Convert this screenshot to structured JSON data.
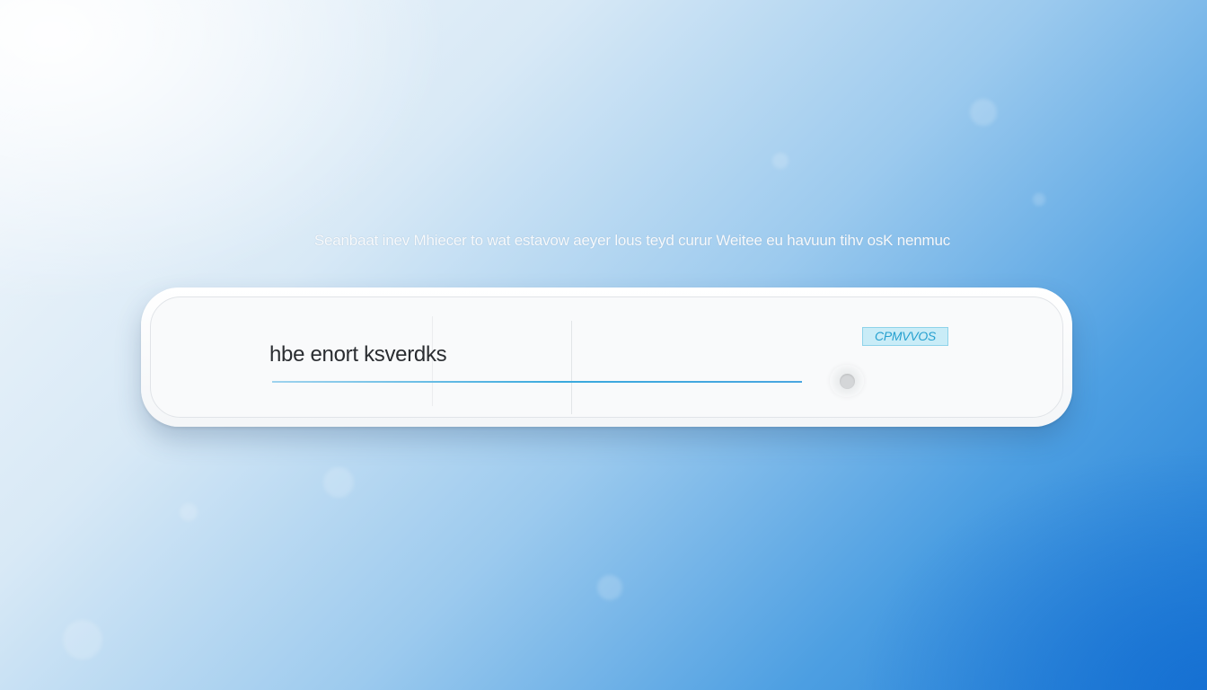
{
  "hint_text": "Seanbaat inev Mhiecer to wat estavow aeyer lous teyd curur Weitee eu havuun tihv osK nenmuc",
  "search": {
    "value": "hbe enort ksverdks",
    "placeholder": ""
  },
  "badge_label": "CPMVVOS",
  "colors": {
    "accent_line": "#3aa9dd",
    "badge_text": "#25a0cf",
    "badge_bg": "#c9ecf7",
    "background_deep": "#1f7dd6"
  },
  "icons": {
    "knob": "toggle-knob-icon"
  }
}
